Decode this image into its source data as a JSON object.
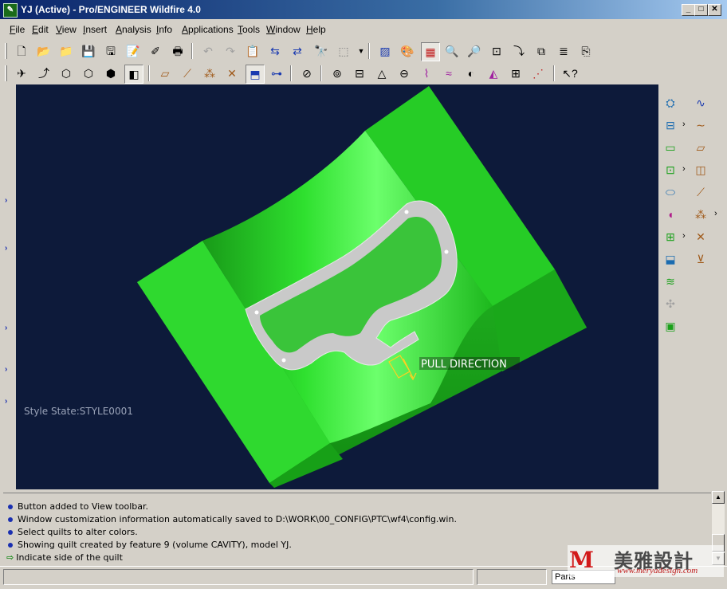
{
  "window": {
    "title": "YJ (Active) - Pro/ENGINEER Wildfire 4.0",
    "app_icon": "proe-icon",
    "controls": [
      "minimize-icon",
      "maximize-icon",
      "close-icon"
    ]
  },
  "menubar": {
    "items": [
      {
        "first": "F",
        "rest": "ile"
      },
      {
        "first": "E",
        "rest": "dit"
      },
      {
        "first": "V",
        "rest": "iew"
      },
      {
        "first": "I",
        "rest": "nsert"
      },
      {
        "first": "A",
        "rest": "nalysis"
      },
      {
        "first": "I",
        "rest": "nfo"
      },
      {
        "first": "A",
        "rest": "pplications"
      },
      {
        "first": "T",
        "rest": "ools"
      },
      {
        "first": "W",
        "rest": "indow"
      },
      {
        "first": "H",
        "rest": "elp"
      }
    ]
  },
  "toolbar_top": {
    "icons": [
      "new-icon",
      "open-icon",
      "open-recent-icon",
      "save-icon",
      "save-copy-icon",
      "print-setup-icon",
      "erase-icon",
      "print-icon",
      "undo-icon",
      "redo-icon",
      "paste-icon",
      "regenerate-icon",
      "regenerate-manager-icon",
      "find-icon",
      "select-box-icon",
      "select-dropdown-icon",
      "sketch-palette-icon",
      "color-palette-icon",
      "appearance-icon",
      "zoom-in-icon",
      "zoom-out-icon",
      "refit-icon",
      "repaint-icon",
      "layers-icon",
      "view-manager-icon",
      "spin-center-icon"
    ]
  },
  "toolbar_second": {
    "icons": [
      "orient-icon",
      "spin-icon",
      "wireframe-icon",
      "hidden-line-icon",
      "no-hidden-icon",
      "shading-icon",
      "datum-plane-display-icon",
      "datum-axis-display-icon",
      "datum-point-display-icon",
      "csys-display-icon",
      "annotation-display-icon",
      "network-icon",
      "hide-icon",
      "measure-icon",
      "distance-icon",
      "area-icon",
      "diameter-icon",
      "curve-analysis-icon",
      "curvature-icon",
      "draft-analysis-icon",
      "shade-analysis-icon",
      "slope-icon",
      "reflection-icon",
      "context-help-icon"
    ]
  },
  "right_toolbar": {
    "col1": [
      "mold-layout-icon",
      "refpart-icon",
      "volume-block-icon",
      "workpiece-icon",
      "shrink-icon",
      "parting-surface-icon",
      "volume-split-icon",
      "mold-component-icon",
      "runner-icon",
      "waterline-icon",
      "mold-open-icon",
      "mold-check-icon"
    ],
    "col2": [
      "sketch-curve-icon",
      "curve-icon",
      "datum-plane-icon",
      "axis-icon",
      "point-icon",
      "csys-icon",
      "analysis-feature-icon"
    ],
    "flyout_symbol": "›"
  },
  "graphics": {
    "background": "#0d1a3a",
    "model_color": "#2bd62b",
    "label": "PULL DIRECTION",
    "style_state": "Style State:STYLE0001"
  },
  "messages": [
    {
      "kind": "info",
      "text": "Button added to View toolbar."
    },
    {
      "kind": "info",
      "text": "Window customization information automatically saved to D:\\WORK\\00_CONFIG\\PTC\\wf4\\config.win."
    },
    {
      "kind": "info",
      "text": "Select quilts to alter colors."
    },
    {
      "kind": "info",
      "text": "Showing quilt created by feature 9 (volume CAVITY), model YJ."
    },
    {
      "kind": "prompt",
      "text": "Indicate side of the quilt"
    }
  ],
  "statusbar": {
    "filter": "Parts"
  },
  "watermark": {
    "logo": "M",
    "name": "美雅設計",
    "url": "www.meryadesign.com"
  }
}
